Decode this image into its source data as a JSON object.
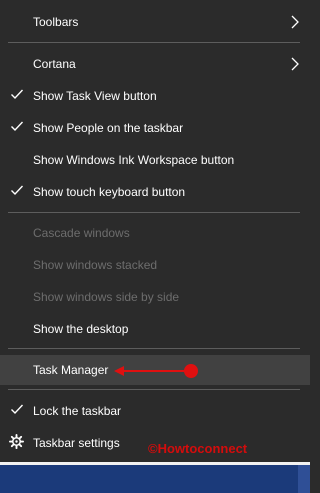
{
  "menu": {
    "items": [
      {
        "label": "Toolbars",
        "checked": false,
        "submenu": true,
        "disabled": false
      },
      {
        "label": "Cortana",
        "checked": false,
        "submenu": true,
        "disabled": false
      },
      {
        "label": "Show Task View button",
        "checked": true,
        "submenu": false,
        "disabled": false
      },
      {
        "label": "Show People on the taskbar",
        "checked": true,
        "submenu": false,
        "disabled": false
      },
      {
        "label": "Show Windows Ink Workspace button",
        "checked": false,
        "submenu": false,
        "disabled": false
      },
      {
        "label": "Show touch keyboard button",
        "checked": true,
        "submenu": false,
        "disabled": false
      },
      {
        "label": "Cascade windows",
        "checked": false,
        "submenu": false,
        "disabled": true
      },
      {
        "label": "Show windows stacked",
        "checked": false,
        "submenu": false,
        "disabled": true
      },
      {
        "label": "Show windows side by side",
        "checked": false,
        "submenu": false,
        "disabled": true
      },
      {
        "label": "Show the desktop",
        "checked": false,
        "submenu": false,
        "disabled": false
      },
      {
        "label": "Task Manager",
        "checked": false,
        "submenu": false,
        "disabled": false,
        "highlighted": true
      },
      {
        "label": "Lock the taskbar",
        "checked": true,
        "submenu": false,
        "disabled": false
      },
      {
        "label": "Taskbar settings",
        "checked": false,
        "submenu": false,
        "disabled": false,
        "icon": "gear-icon"
      }
    ]
  },
  "watermark": "©Howtoconnect",
  "colors": {
    "menu_bg": "#2b2b2b",
    "hover_bg": "#414141",
    "text": "#ffffff",
    "disabled_text": "#6d6d6d",
    "annotation_red": "#e01010",
    "taskbar": "#1b3a7a"
  },
  "icons": {
    "check": "checkmark-icon",
    "submenu": "chevron-right-icon",
    "settings": "gear-icon"
  }
}
